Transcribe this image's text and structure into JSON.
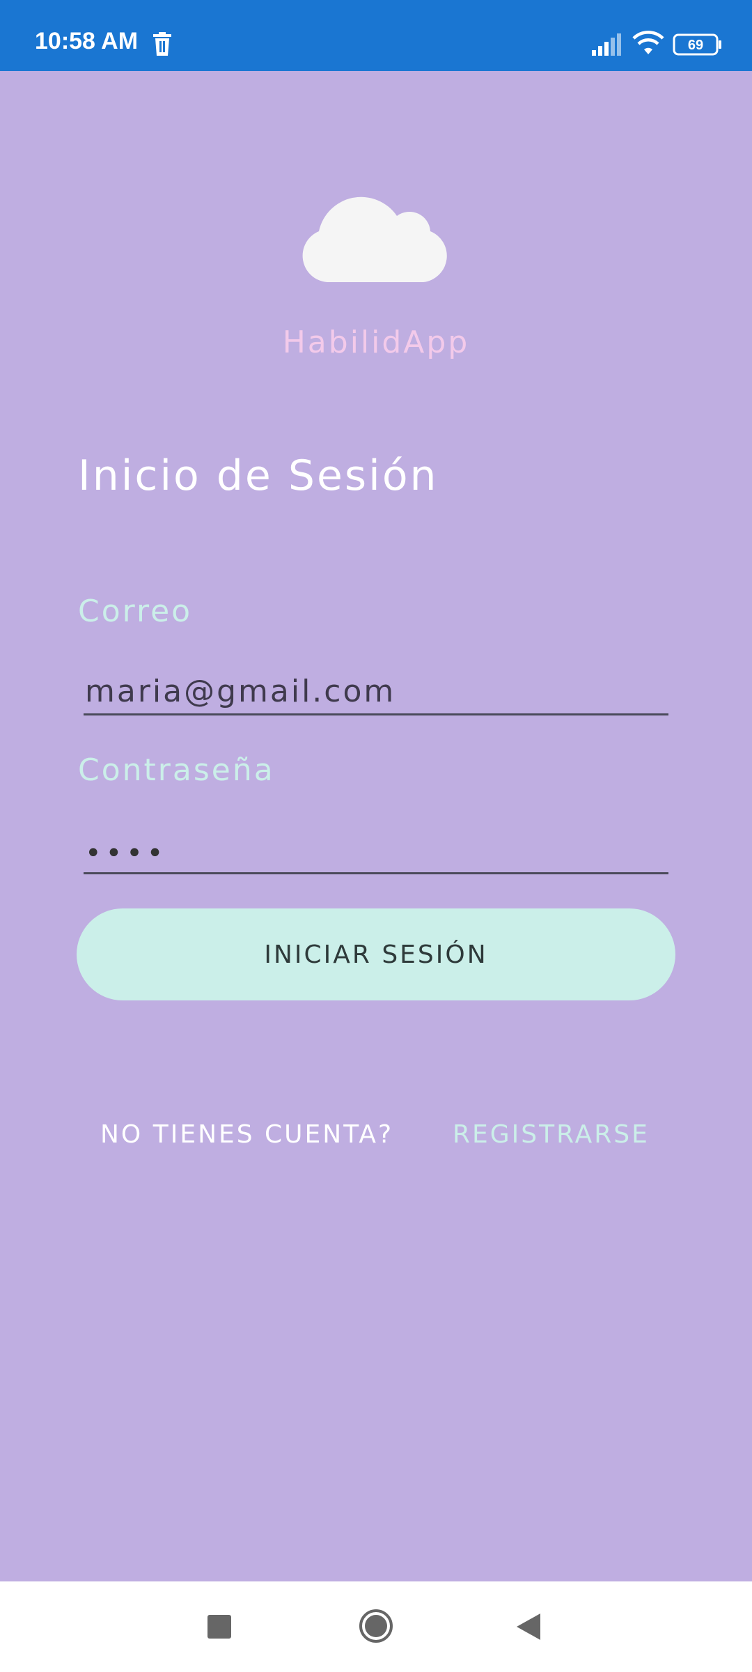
{
  "status_bar": {
    "time": "10:58 AM",
    "battery": "69",
    "icons": [
      "trash-icon",
      "signal-icon",
      "wifi-icon",
      "battery-icon"
    ]
  },
  "logo": {
    "icon": "cloud-icon",
    "app_name": "HabilidApp"
  },
  "login": {
    "title": "Inicio de Sesión",
    "email_label": "Correo",
    "email_value": "maria@gmail.com",
    "password_label": "Contraseña",
    "password_value": "••••",
    "submit_label": "INICIAR SESIÓN"
  },
  "footer": {
    "no_account": "NO TIENES CUENTA?",
    "register": "REGISTRARSE"
  },
  "colors": {
    "background": "#BFAEE1",
    "status_bar": "#1A76D2",
    "accent_mint": "#CBEFE9",
    "app_name_pink": "#F3CAEA"
  },
  "nav_bar": {
    "icons": [
      "recents-icon",
      "home-icon",
      "back-icon"
    ]
  }
}
